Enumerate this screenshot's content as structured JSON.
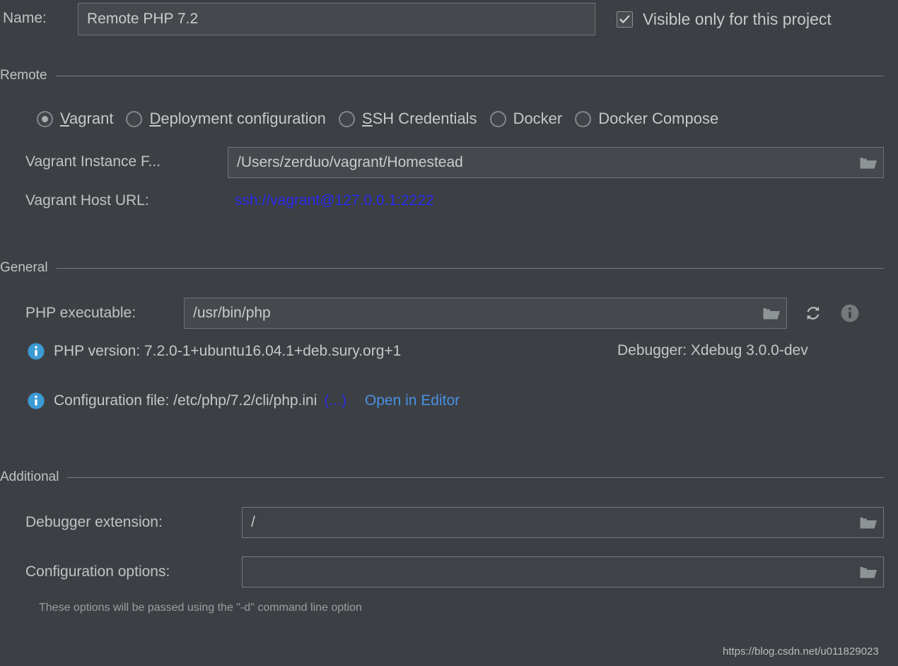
{
  "name_row": {
    "label": "Name:",
    "value": "Remote PHP 7.2",
    "visible_checkbox_label": "Visible only for this project",
    "visible_checkbox_checked": "✔"
  },
  "remote_section": {
    "title": "Remote",
    "options": [
      {
        "label": "Vagrant",
        "mnemonic": "V",
        "rest": "agrant",
        "selected": true
      },
      {
        "label": "Deployment configuration",
        "mnemonic": "D",
        "rest": "eployment configuration",
        "selected": false
      },
      {
        "label": "SSH Credentials",
        "mnemonic": "S",
        "rest": "SH Credentials",
        "selected": false
      },
      {
        "label": "Docker",
        "mnemonic": "",
        "rest": "Docker",
        "selected": false
      },
      {
        "label": "Docker Compose",
        "mnemonic": "",
        "rest": "Docker Compose",
        "selected": false
      }
    ],
    "instance_folder_label": "Vagrant Instance F...",
    "instance_folder_value": "/Users/zerduo/vagrant/Homestead",
    "host_url_label": "Vagrant Host URL:",
    "host_url_value": "ssh://vagrant@127.0.0.1:2222"
  },
  "general_section": {
    "title": "General",
    "php_executable_label": "PHP executable:",
    "php_executable_value": "/usr/bin/php",
    "refresh_icon": "refresh-icon",
    "info_icon": "info-icon",
    "php_version_text": "PHP version: 7.2.0-1+ubuntu16.04.1+deb.sury.org+1",
    "debugger_text": "Debugger: Xdebug 3.0.0-dev",
    "config_file_text": "Configuration file: /etc/php/7.2/cli/php.ini",
    "config_file_more": "(...)",
    "open_in_editor": "Open in Editor"
  },
  "additional_section": {
    "title": "Additional",
    "debugger_extension_label": "Debugger extension:",
    "debugger_extension_value": "/",
    "configuration_options_label": "Configuration options:",
    "configuration_options_value": "",
    "hint": "These options will be passed using the \"-d\" command line option"
  },
  "watermark": "https://blog.csdn.net/u011829023",
  "colors": {
    "background": "#3c4044",
    "field_background": "#45494d",
    "field_border": "#6e7376",
    "text": "#c5c8c9",
    "link_blue": "#4a90e2",
    "link_strong_blue": "#2b2beb",
    "info_icon_blue": "#3c9ad4",
    "separator": "#767b7e"
  }
}
